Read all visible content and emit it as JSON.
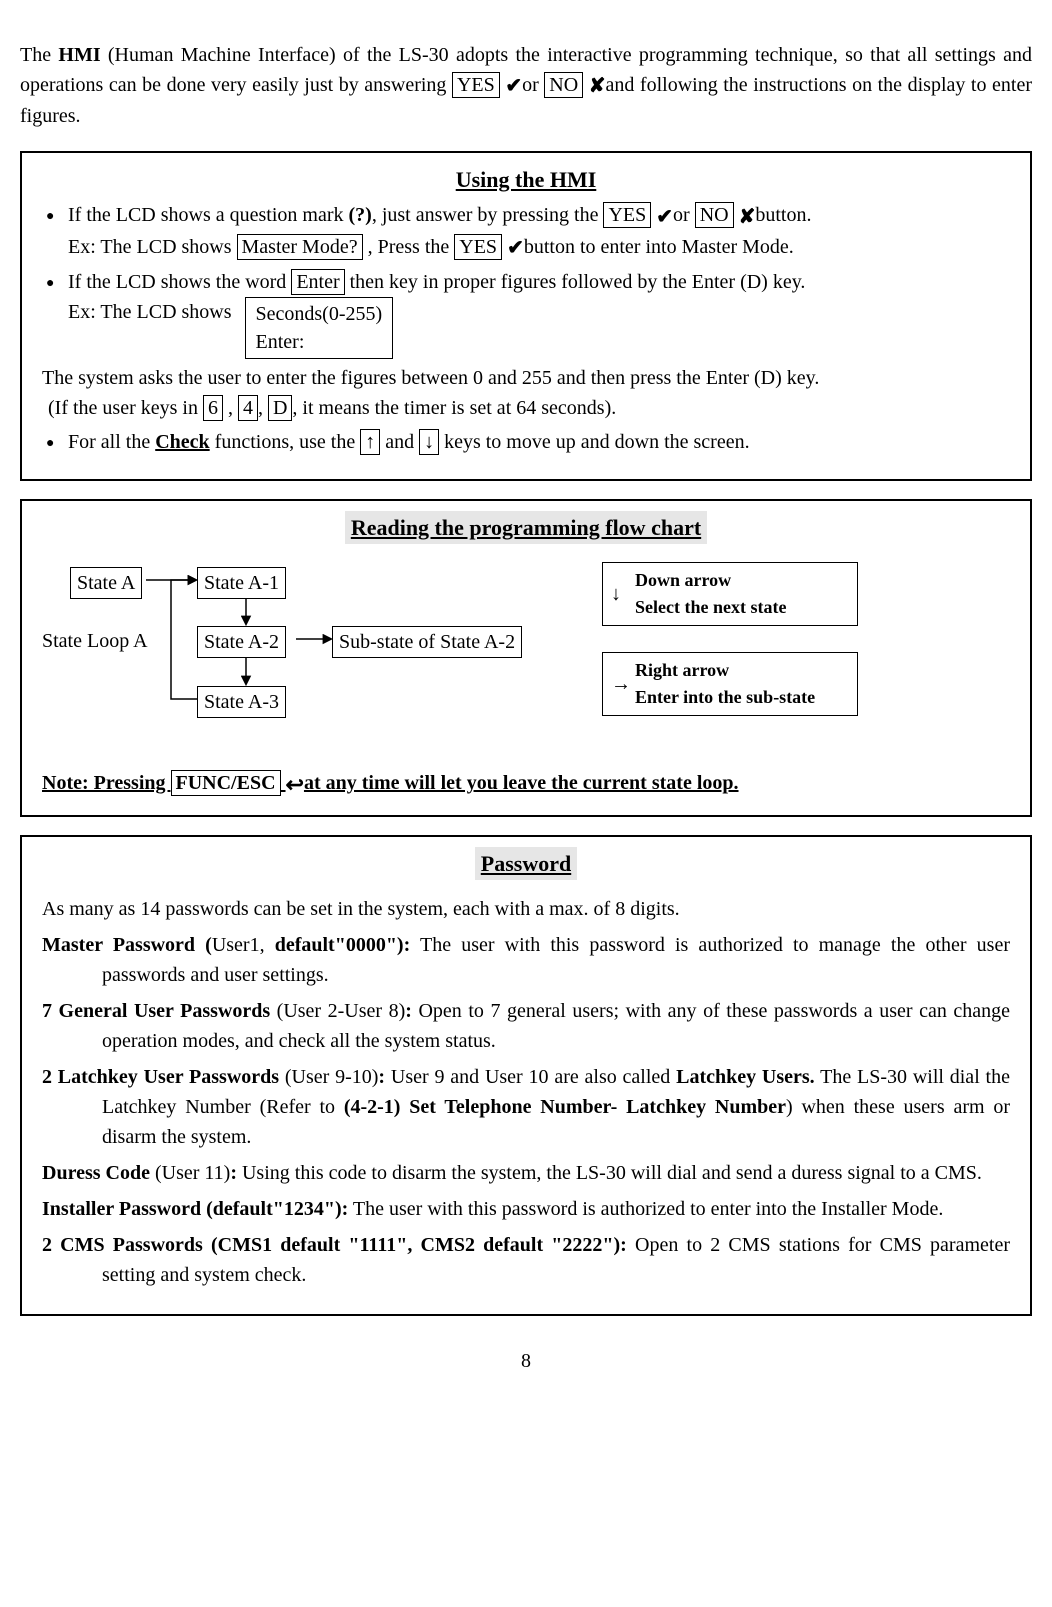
{
  "intro": {
    "p1a": "The ",
    "hmi": "HMI",
    "p1b": " (Human Machine Interface) of the LS-30 adopts the interactive programming technique, so that all settings and operations can be done very easily just by answering ",
    "yes": "YES",
    "or": "or ",
    "no": "NO",
    "p1c": "and following the instructions on the display to enter figures."
  },
  "hmi_box": {
    "title": "Using the HMI",
    "b1a": "If the LCD shows a question mark ",
    "qmark": "(?)",
    "b1b": ", just answer by pressing the ",
    "yes": "YES",
    "or": "or ",
    "no": "NO",
    "b1c": "button.",
    "ex1a": "Ex: The LCD shows ",
    "master": "Master Mode?",
    "ex1b": " , Press the ",
    "ex1c": "button to enter into Master Mode.",
    "b2a": "If the LCD shows the word ",
    "enter": "Enter",
    "b2b": " then key in proper figures followed by the Enter (D) key.",
    "ex2a": "Ex: The LCD shows",
    "lcd1": "Seconds(0-255)",
    "lcd2": "Enter:",
    "sys": "The system asks the user to enter the figures between 0 and 255 and then press the Enter (D) key.",
    "if_a": "(If the user keys in ",
    "k6": "6",
    "comma1": " , ",
    "k4": "4",
    "comma2": ", ",
    "kD": "D",
    "if_b": ", it means the timer is set at 64 seconds).",
    "b3a": "For all the ",
    "check": "Check",
    "b3b": " functions, use the ",
    "up": "↑",
    "and": " and ",
    "down": "↓",
    "b3c": " keys to move up and down the screen."
  },
  "flow": {
    "title": "Reading the programming flow chart",
    "stateA": "State A",
    "stateA1": "State A-1",
    "stateA2": "State A-2",
    "stateA3": "State A-3",
    "substate": "Sub-state of State A-2",
    "loop": "State Loop A",
    "legend1a": "Down arrow",
    "legend1b": "Select the next state",
    "legend2a": "Right arrow",
    "legend2b": "Enter into the sub-state",
    "note_a": "Note: Pressing ",
    "func": "FUNC/ESC",
    "note_b": "at any time will let you leave the current state loop."
  },
  "pw": {
    "title": "Password",
    "intro": "As many as 14 passwords can be set in the system, each with a max. of 8 digits.",
    "mp_a": "Master Password (",
    "mp_u": "User1, ",
    "mp_b": "default\"0000\"):",
    "mp_t": " The user with this password is authorized to manage the other user passwords and user settings.",
    "gu_a": "7 General User Passwords",
    "gu_u": " (User 2-User 8)",
    "gu_b": ":",
    "gu_t": " Open to 7 general users; with any of these passwords a user can change operation modes, and check all the system status.",
    "lk_a": "2 Latchkey User Passwords",
    "lk_u": " (User 9-10)",
    "lk_b": ":",
    "lk_t1": " User 9 and User 10 are also called ",
    "lk_t2": "Latchkey Users.",
    "lk_t3": " The LS-30 will dial the Latchkey Number (Refer to ",
    "lk_t4": "(4-2-1) Set Telephone Number- Latchkey Number",
    "lk_t5": ") when these users arm or disarm the system.",
    "du_a": "Duress Code",
    "du_u": " (User 11)",
    "du_b": ":",
    "du_t": " Using this code to disarm the system, the LS-30 will dial and send a duress signal to a CMS.",
    "in_a": "Installer Password (default\"1234\"):",
    "in_t": " The user with this password is authorized to enter into the Installer Mode.",
    "cm_a": "2 CMS Passwords (CMS1 default \"1111\", CMS2 default \"2222\"):",
    "cm_t": " Open to 2 CMS stations for CMS parameter setting and system check."
  },
  "page": "8"
}
